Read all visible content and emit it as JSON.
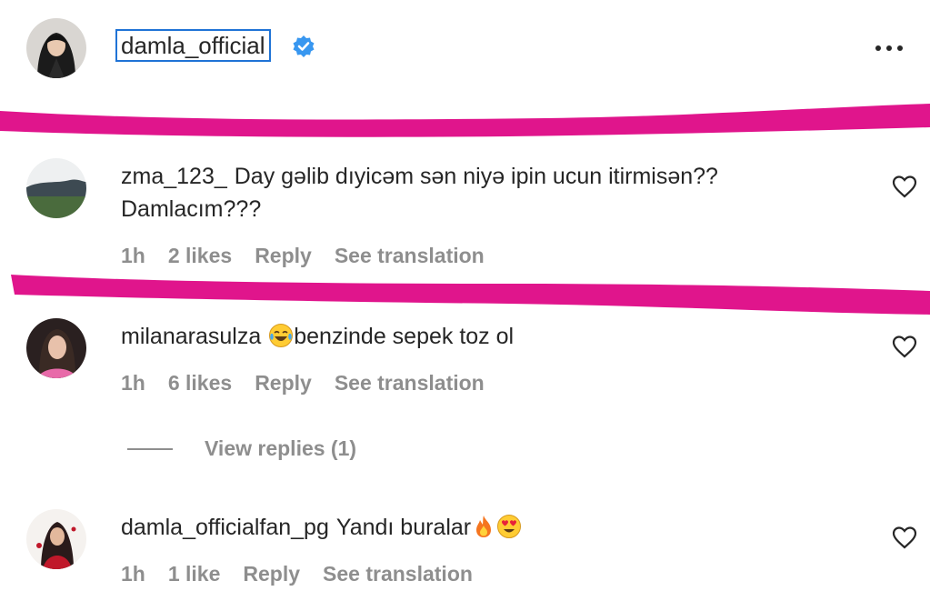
{
  "post": {
    "username": "damla_official",
    "avatar": "profile-photo"
  },
  "comments": [
    {
      "username": "zma_123_",
      "text": "Day gəlib dıyicəm sən niyə ipin ucun itirmisən??",
      "text_line2": "Damlacım???",
      "time": "1h",
      "likes": "2 likes",
      "reply": "Reply",
      "translate": "See translation"
    },
    {
      "username": "milanarasulza",
      "text": "benzinde sepek toz ol",
      "time": "1h",
      "likes": "6 likes",
      "reply": "Reply",
      "translate": "See translation",
      "view_replies": "View replies (1)"
    },
    {
      "username": "damla_officialfan_pg",
      "text": "Yandı buralar",
      "time": "1h",
      "likes": "1 like",
      "reply": "Reply",
      "translate": "See translation"
    }
  ],
  "icons": {
    "verified": "verified-badge-icon",
    "more": "more-options-icon",
    "like": "heart-icon",
    "emoji_laugh": "face-with-tears-of-joy",
    "emoji_fire": "fire",
    "emoji_heart_eyes": "heart-eyes"
  },
  "colors": {
    "accent_blue": "#1f73d6",
    "verified": "#3897f0",
    "highlight_marker": "#e0158c",
    "muted_text": "#8e8e8e"
  }
}
